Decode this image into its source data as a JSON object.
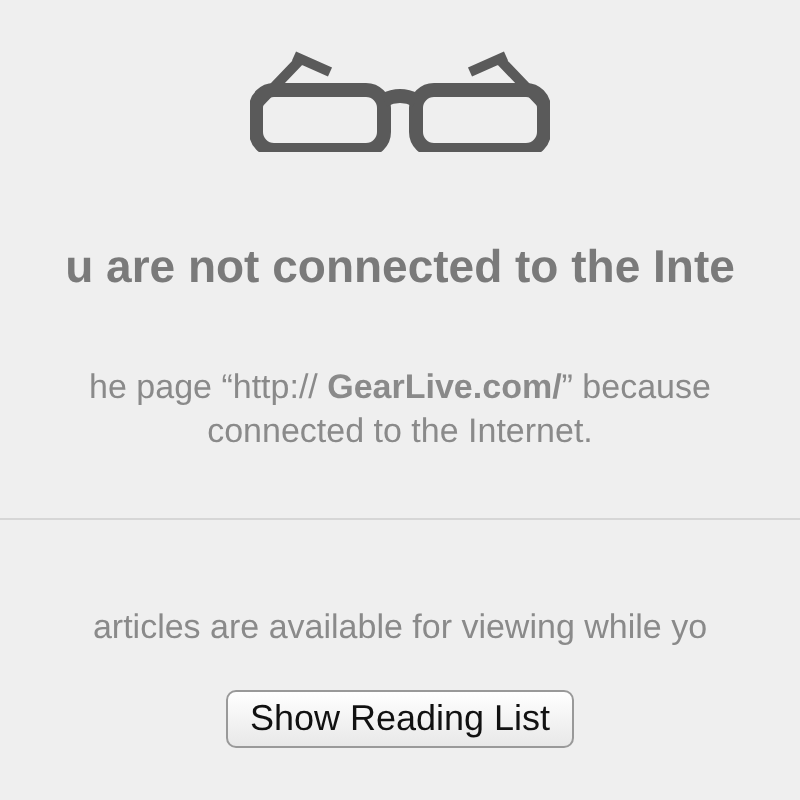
{
  "title": "u are not connected to the Inte",
  "message_lines": [
    "he page “http:// **GearLive.com/**” because",
    "connected to the Internet."
  ],
  "reading_list_text": "articles are available for viewing while yo",
  "button": "Show Reading List"
}
